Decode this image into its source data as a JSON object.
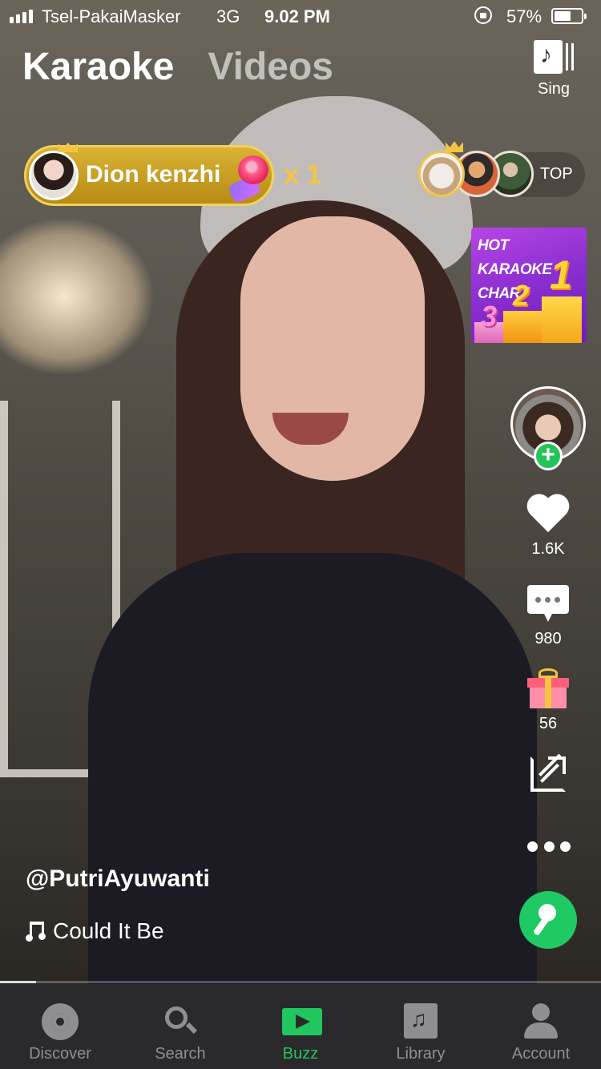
{
  "status_bar": {
    "carrier": "Tsel-PakaiMasker",
    "network": "3G",
    "time": "9.02 PM",
    "battery_percent": "57%",
    "battery_level": 0.57
  },
  "top_tabs": {
    "karaoke": "Karaoke",
    "videos": "Videos"
  },
  "sing_button": {
    "label": "Sing",
    "icon": "music-sheet-icon"
  },
  "gift_banner": {
    "sender_name": "Dion kenzhi",
    "gift_icon": "rose-icon",
    "count": "x 1"
  },
  "top_users": {
    "label": "TOP"
  },
  "hot_chart": {
    "title": "HOT KARAOKE CHART"
  },
  "actions": {
    "likes": "1.6K",
    "comments": "980",
    "gifts": "56"
  },
  "caption": {
    "username": "@PutriAyuwanti",
    "song": "Could It Be"
  },
  "playback": {
    "progress": 0.06
  },
  "bottom_nav": {
    "items": [
      {
        "label": "Discover",
        "icon": "discover-icon"
      },
      {
        "label": "Search",
        "icon": "search-icon"
      },
      {
        "label": "Buzz",
        "icon": "buzz-icon",
        "active": true
      },
      {
        "label": "Library",
        "icon": "library-icon"
      },
      {
        "label": "Account",
        "icon": "account-icon"
      }
    ]
  },
  "colors": {
    "accent_green": "#21c65e",
    "gift_gold": "#f5c542",
    "nav_bg": "#2a2a2c"
  }
}
